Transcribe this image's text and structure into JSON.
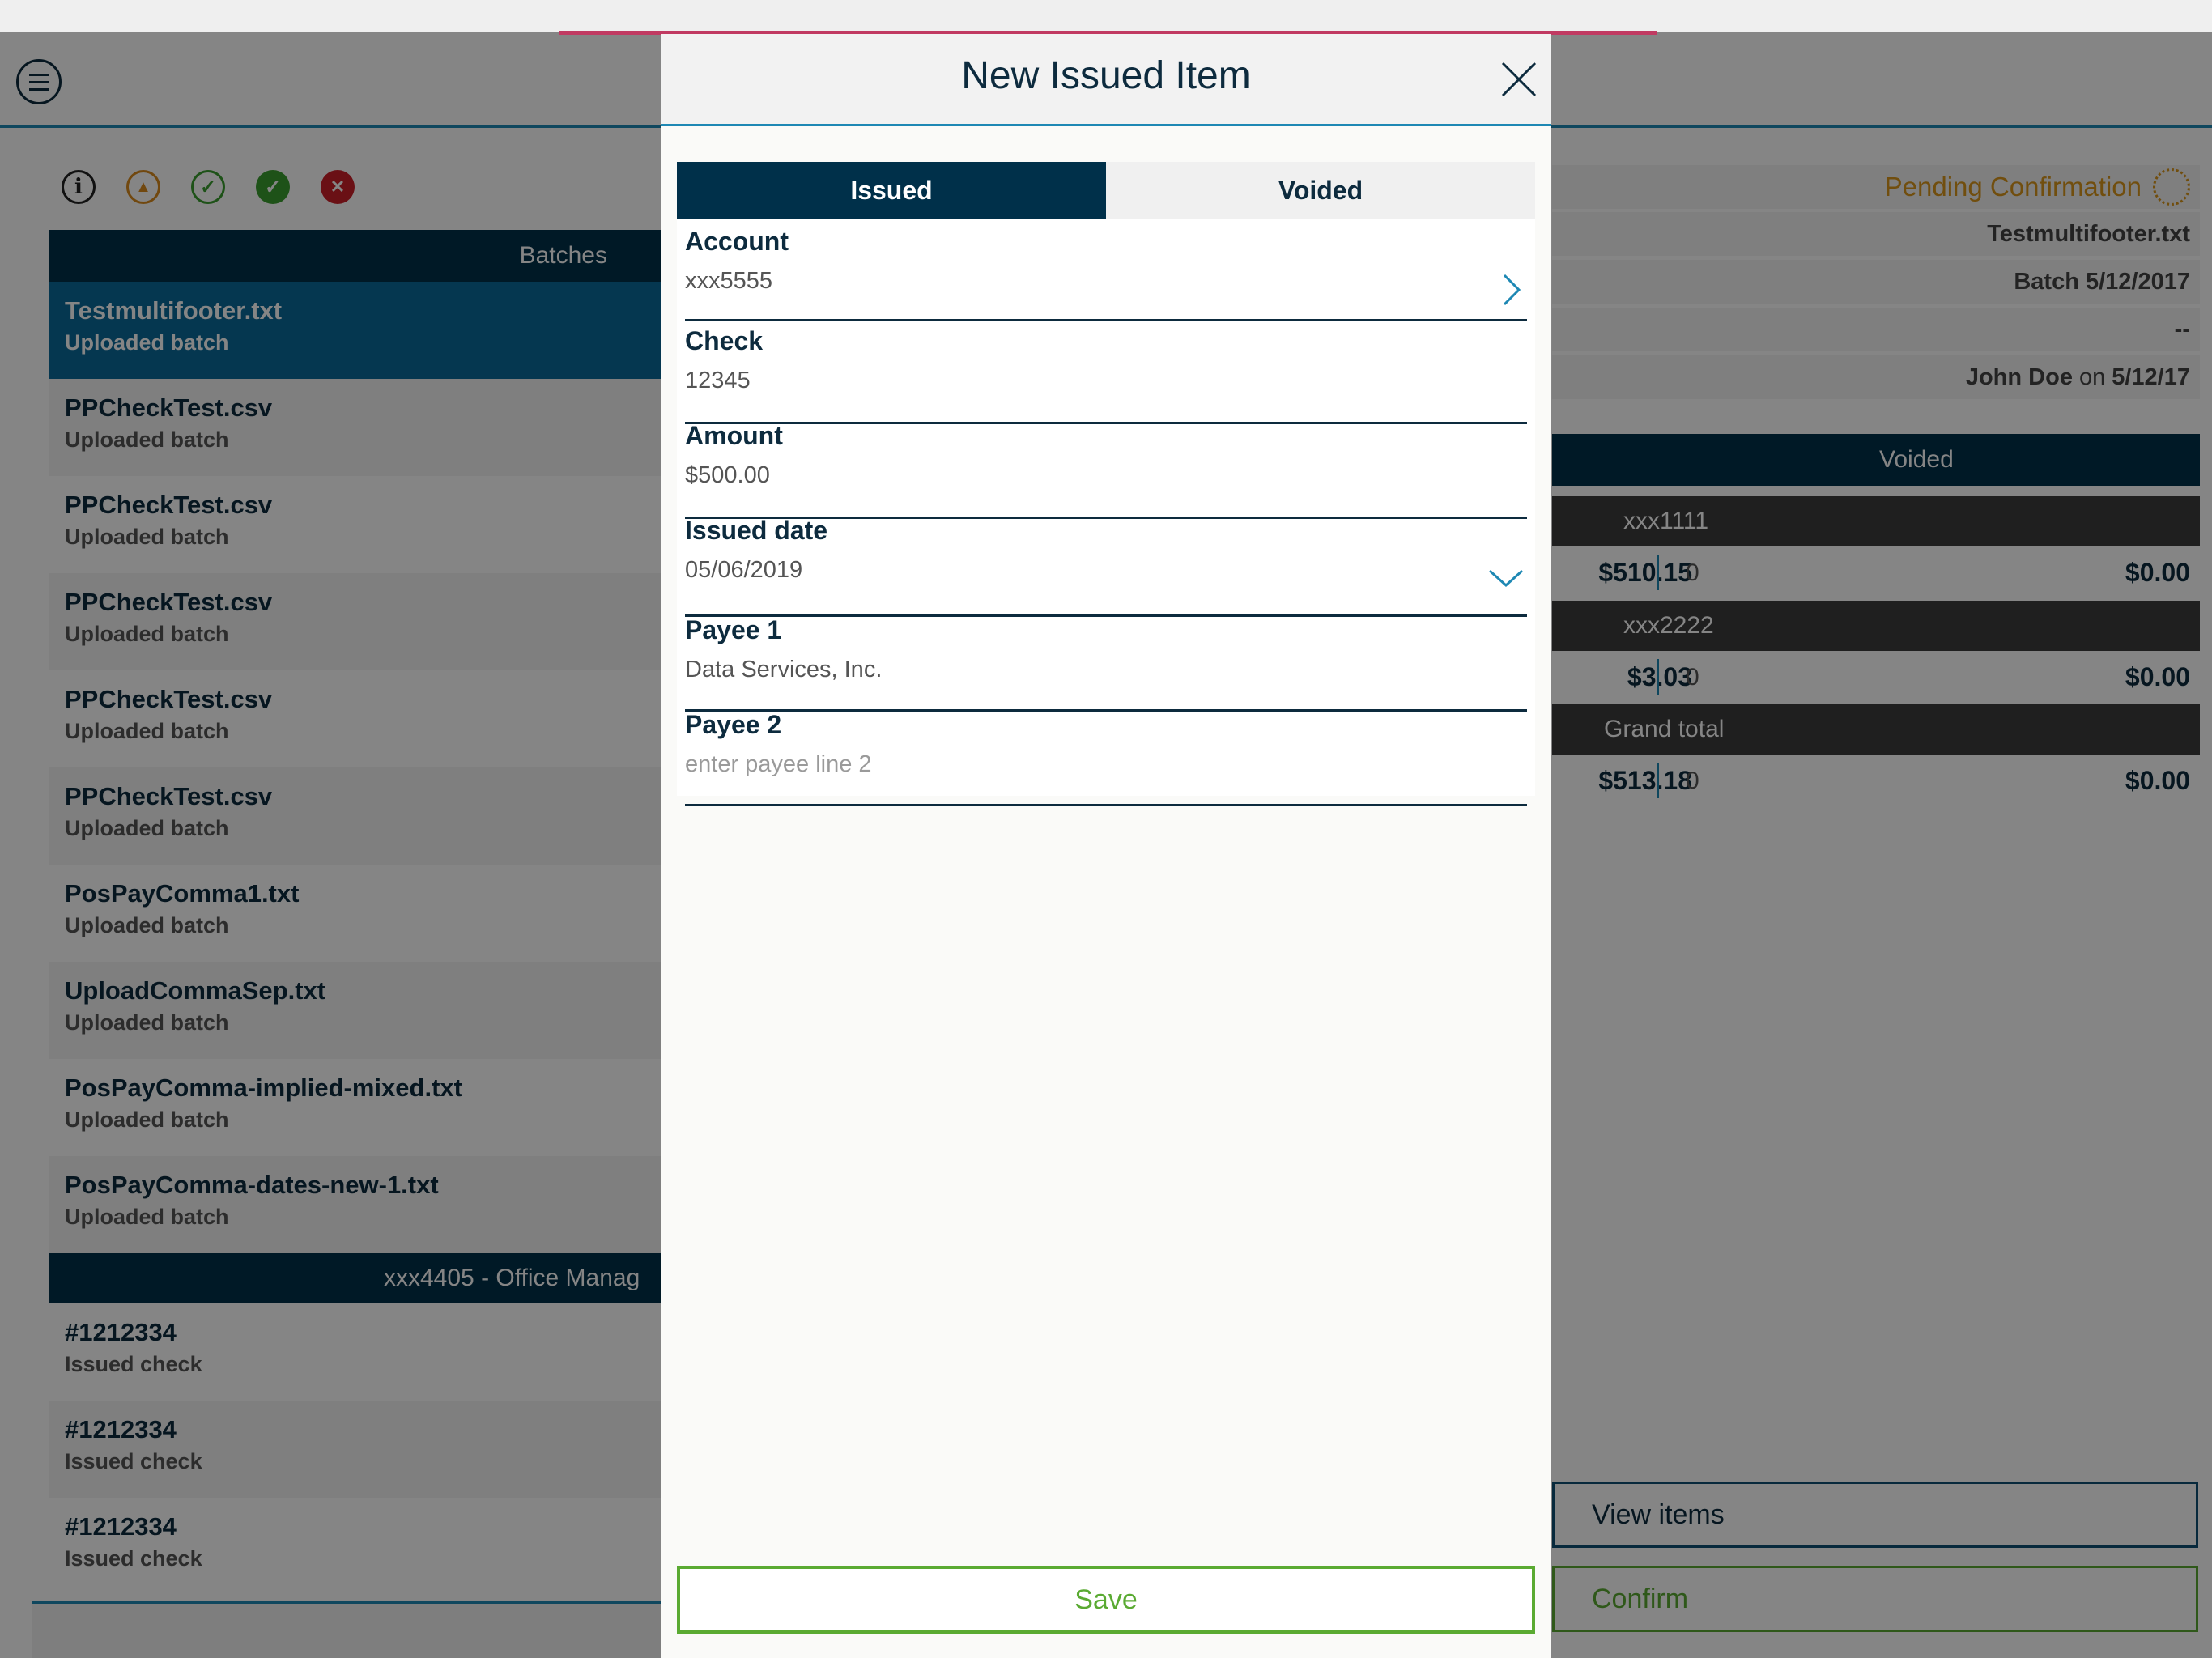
{
  "toolbar_icons": [
    "info-icon",
    "bank-icon",
    "check-outline-icon",
    "check-filled-icon",
    "x-filled-icon"
  ],
  "batches": {
    "header": "Batches",
    "items": [
      {
        "name": "Testmultifooter.txt",
        "sub": "Uploaded batch"
      },
      {
        "name": "PPCheckTest.csv",
        "sub": "Uploaded batch"
      },
      {
        "name": "PPCheckTest.csv",
        "sub": "Uploaded batch"
      },
      {
        "name": "PPCheckTest.csv",
        "sub": "Uploaded batch"
      },
      {
        "name": "PPCheckTest.csv",
        "sub": "Uploaded batch"
      },
      {
        "name": "PPCheckTest.csv",
        "sub": "Uploaded batch"
      },
      {
        "name": "PosPayComma1.txt",
        "sub": "Uploaded batch"
      },
      {
        "name": "UploadCommaSep.txt",
        "sub": "Uploaded batch"
      },
      {
        "name": "PosPayComma-implied-mixed.txt",
        "sub": "Uploaded batch"
      },
      {
        "name": "PosPayComma-dates-new-1.txt",
        "sub": "Uploaded batch"
      }
    ]
  },
  "account_group": {
    "header": "xxx4405 - Office Manag",
    "items": [
      {
        "name": "#1212334",
        "sub": "Issued check"
      },
      {
        "name": "#1212334",
        "sub": "Issued check"
      },
      {
        "name": "#1212334",
        "sub": "Issued check"
      }
    ]
  },
  "details": {
    "status": "Pending Confirmation",
    "file": "Testmultifooter.txt",
    "batch": "Batch 5/12/2017",
    "placeholder": "--",
    "user": "John Doe",
    "on": "on",
    "date": "5/12/17",
    "voided_header": "Voided",
    "accounts": [
      {
        "account": "xxx1111",
        "amount": "$510.15",
        "count": "0",
        "voided": "$0.00"
      },
      {
        "account": "xxx2222",
        "amount": "$3.03",
        "count": "0",
        "voided": "$0.00"
      }
    ],
    "grand_total": {
      "label": "Grand total",
      "amount": "$513.18",
      "count": "0",
      "voided": "$0.00"
    },
    "view_items": "View items",
    "confirm": "Confirm"
  },
  "modal": {
    "title": "New Issued Item",
    "tabs": {
      "issued": "Issued",
      "voided": "Voided"
    },
    "fields": {
      "account": {
        "label": "Account",
        "value": "xxx5555"
      },
      "check": {
        "label": "Check",
        "value": "12345"
      },
      "amount": {
        "label": "Amount",
        "value": "$500.00"
      },
      "issued_date": {
        "label": "Issued date",
        "value": "05/06/2019"
      },
      "payee1": {
        "label": "Payee 1",
        "value": "Data Services, Inc."
      },
      "payee2": {
        "label": "Payee 2",
        "placeholder": "enter payee line 2"
      }
    },
    "save": "Save",
    "colors": {
      "navy": "#00304a",
      "accent": "#1e88b4",
      "green": "#5aaa32",
      "pending": "#d8961c"
    }
  }
}
